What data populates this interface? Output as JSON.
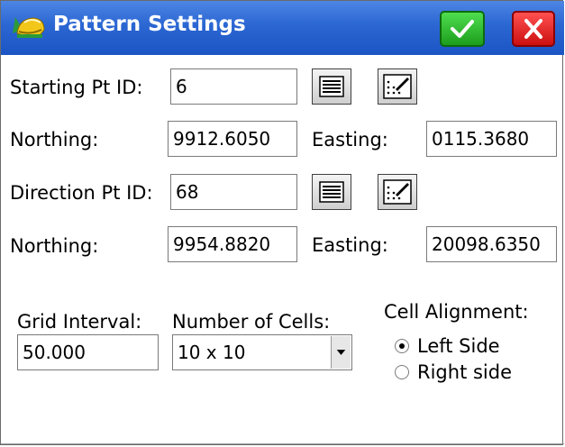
{
  "window": {
    "title": "Pattern Settings",
    "accent_color": "#2b66d2",
    "ok_icon": "check-icon",
    "close_icon": "close-icon"
  },
  "starting_point": {
    "id_label": "Starting Pt ID:",
    "id_value": "6",
    "list_icon": "list-icon",
    "map_icon": "map-pick-icon",
    "northing_label": "Northing:",
    "northing_value": "9912.6050",
    "easting_label": "Easting:",
    "easting_value": "0115.3680"
  },
  "direction_point": {
    "id_label": "Direction Pt ID:",
    "id_value": "68",
    "list_icon": "list-icon",
    "map_icon": "map-pick-icon",
    "northing_label": "Northing:",
    "northing_value": "9954.8820",
    "easting_label": "Easting:",
    "easting_value": "20098.6350"
  },
  "grid": {
    "interval_label": "Grid Interval:",
    "interval_value": "50.000",
    "cells_label": "Number of Cells:",
    "cells_value": "10 x 10",
    "dropdown_icon": "chevron-down-icon"
  },
  "alignment": {
    "label": "Cell Alignment:",
    "options": [
      {
        "label": "Left Side",
        "selected": true
      },
      {
        "label": "Right side",
        "selected": false
      }
    ]
  }
}
